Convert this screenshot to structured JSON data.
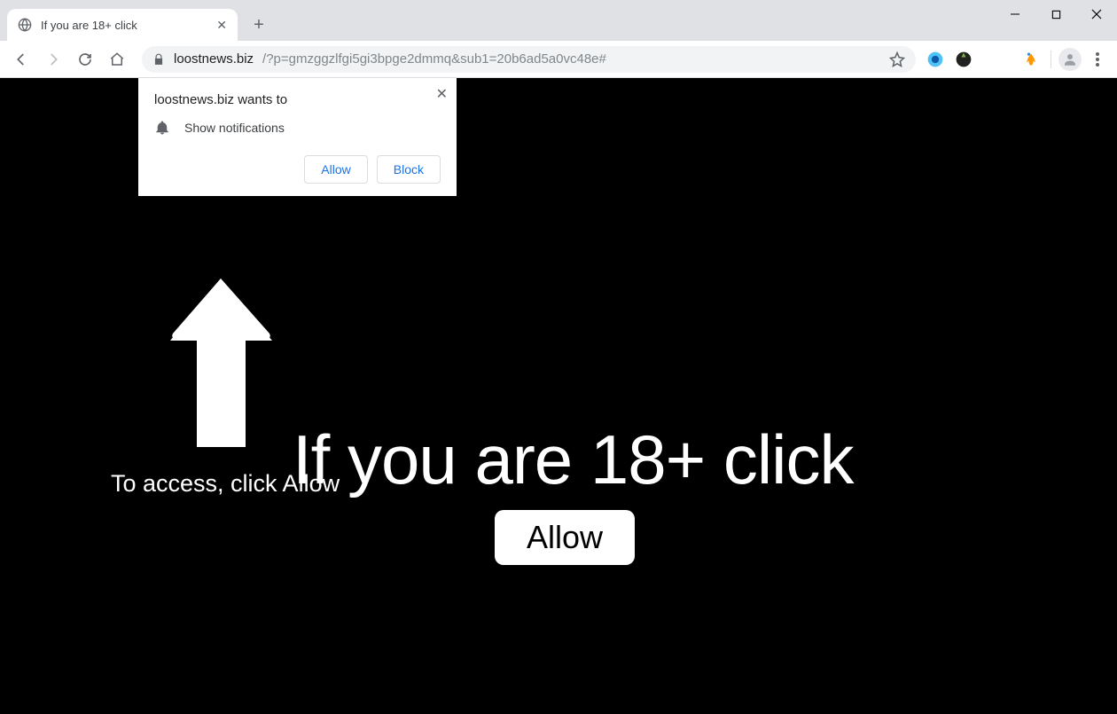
{
  "tab": {
    "title": "If you are 18+ click"
  },
  "url": {
    "host": "loostnews.biz",
    "path": "/?p=gmzggzlfgi5gi3bpge2dmmq&sub1=20b6ad5a0vc48e#"
  },
  "popup": {
    "wants": "loostnews.biz wants to",
    "permission": "Show notifications",
    "allow": "Allow",
    "block": "Block"
  },
  "page": {
    "access": "To access, click Allow",
    "headline": "If you are 18+ click",
    "allow_button": "Allow"
  }
}
